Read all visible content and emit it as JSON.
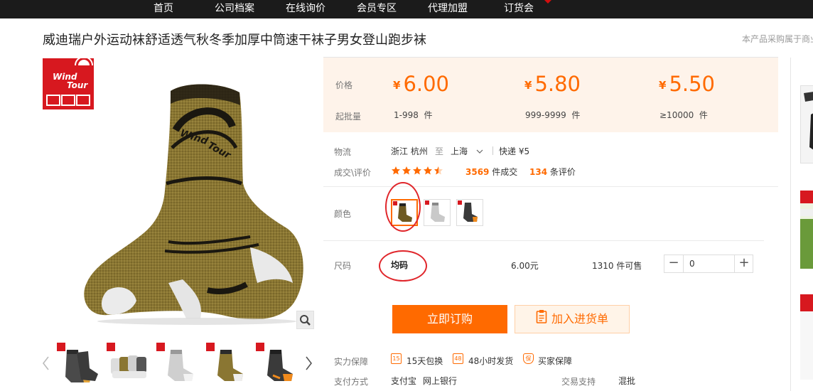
{
  "nav": {
    "items": [
      "首页",
      "公司档案",
      "在线询价",
      "会员专区",
      "代理加盟",
      "订货会"
    ]
  },
  "product": {
    "title": "威迪瑞户外运动袜舒适透气秋冬季加厚中筒速干袜子男女登山跑步袜",
    "right_note": "本产品采购属于商业"
  },
  "price_box": {
    "price_label": "价格",
    "moq_label": "起批量",
    "currency": "¥",
    "tiers": [
      {
        "price": "6.00",
        "range": "1-998",
        "unit": "件"
      },
      {
        "price": "5.80",
        "range": "999-9999",
        "unit": "件"
      },
      {
        "price": "5.50",
        "range": "≥10000",
        "unit": "件"
      }
    ]
  },
  "logistics": {
    "label": "物流",
    "from": "浙江 杭州",
    "to_word": "至",
    "dest": "上海",
    "method": "快递",
    "fee": "¥5"
  },
  "trade": {
    "label": "成交\\评价",
    "rating": 4.5,
    "deals": "3569",
    "deals_suffix": "件成交",
    "reviews": "134",
    "reviews_suffix": "条评价"
  },
  "color": {
    "label": "颜色",
    "options": [
      "brown",
      "grey",
      "black-orange"
    ],
    "selected": 0
  },
  "size": {
    "label": "尺码",
    "value": "均码",
    "price": "6.00元",
    "stock": "1310",
    "stock_suffix": "件可售",
    "quantity": "0"
  },
  "actions": {
    "buy_now": "立即订购",
    "add_cart": "加入进货单"
  },
  "guarantee": {
    "label": "实力保障",
    "items": [
      {
        "icon": "calendar-15-icon",
        "text": "15天包换"
      },
      {
        "icon": "clock-48-icon",
        "text": "48小时发货"
      },
      {
        "icon": "shield-icon",
        "text": "买家保障"
      }
    ]
  },
  "payment": {
    "label": "支付方式",
    "methods": [
      "支付宝",
      "网上银行"
    ],
    "trade_support_label": "交易支持",
    "trade_support": "混批"
  },
  "thumbnails": [
    "thumb-1",
    "thumb-2",
    "thumb-3",
    "thumb-4",
    "thumb-5"
  ],
  "colors": {
    "accent": "#ff6a00",
    "nav_bg": "#1b1b1b",
    "price_bg": "#fef3ea",
    "brand_red": "#d7181f",
    "annotation_red": "#e0262b"
  }
}
